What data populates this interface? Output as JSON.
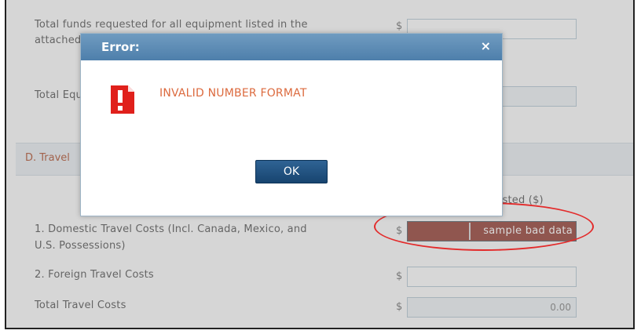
{
  "form": {
    "row_total_funds_line1": "Total funds requested for all equipment listed in the",
    "row_total_funds_line2": "attached file",
    "row_total_e_label": "Total Equipment",
    "section_title": "D. Travel",
    "column_header": "Funds Requested ($)",
    "currency_symbol": "$",
    "domestic_label_line1": "1. Domestic Travel Costs (Incl. Canada, Mexico, and",
    "domestic_label_line2": "U.S. Possessions)",
    "domestic_value": "sample bad data",
    "foreign_label": "2. Foreign Travel Costs",
    "foreign_value": "",
    "total_label": "Total Travel Costs",
    "total_value": "0.00"
  },
  "dialog": {
    "title": "Error:",
    "close_glyph": "×",
    "message": "INVALID NUMBER FORMAT",
    "ok_label": "OK",
    "icon": "error-document-icon",
    "colors": {
      "titlebar": "#5a8ab4",
      "message": "#dc6a3e",
      "ok_button": "#1e4f7e",
      "icon": "#e0201b"
    }
  },
  "annotation": {
    "ring_color": "#e32b2b"
  }
}
